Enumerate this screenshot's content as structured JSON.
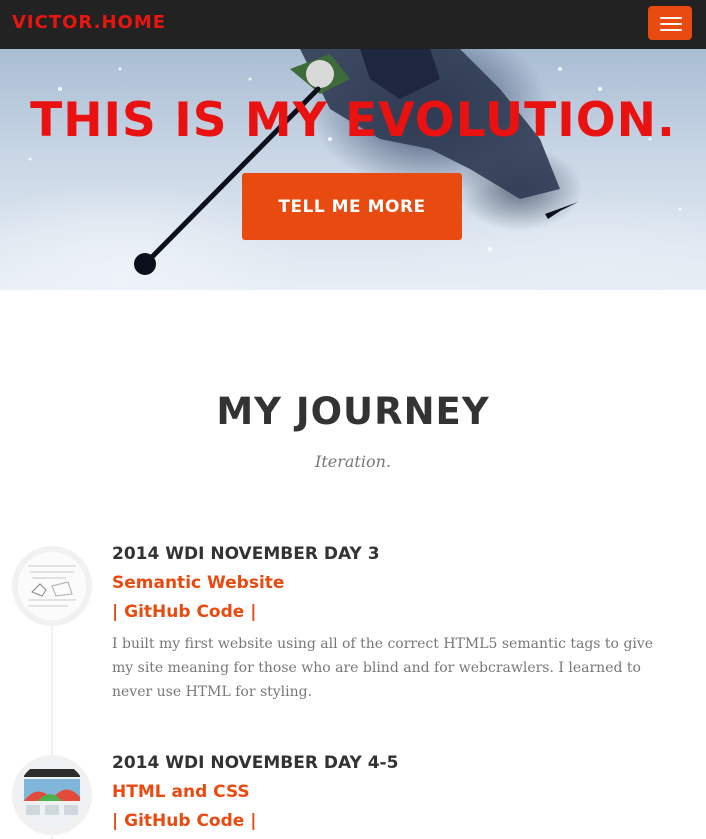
{
  "navbar": {
    "brand": "VICTOR.HOME",
    "menu_icon": "hamburger-menu-icon"
  },
  "hero": {
    "title": "THIS IS MY EVOLUTION.",
    "button_label": "TELL ME MORE"
  },
  "journey": {
    "title": "MY JOURNEY",
    "subtitle": "Iteration.",
    "items": [
      {
        "date": "2014 WDI NOVEMBER DAY 3",
        "title": "Semantic Website",
        "link": "| GitHub Code |",
        "body": "I built my first website using all of the correct HTML5 semantic tags to give my site meaning for those who are blind and for webcrawlers. I learned to never use HTML for styling."
      },
      {
        "date": "2014 WDI NOVEMBER DAY 4-5",
        "title": "HTML and CSS",
        "link": "| GitHub Code |"
      }
    ]
  },
  "colors": {
    "brand_red": "#ea1111",
    "accent_orange": "#e84a10",
    "navbar_bg": "#222222"
  }
}
